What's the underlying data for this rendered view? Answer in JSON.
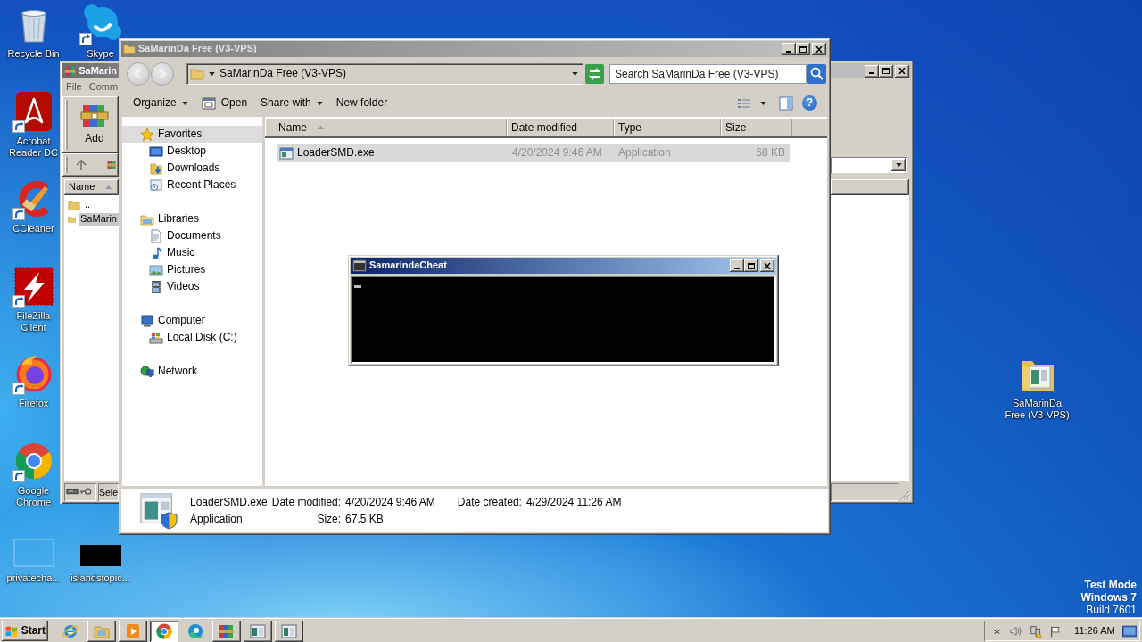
{
  "desktop_icons": [
    {
      "label": "Recycle Bin",
      "shortcut": false
    },
    {
      "label": "Skype",
      "shortcut": true
    },
    {
      "label": "Acrobat Reader DC",
      "shortcut": true
    },
    {
      "label": "CCleaner",
      "shortcut": true
    },
    {
      "label": "FileZilla Client",
      "shortcut": true
    },
    {
      "label": "Firefox",
      "shortcut": true
    },
    {
      "label": "Google Chrome",
      "shortcut": true
    },
    {
      "label": "privatecha...",
      "shortcut": false
    },
    {
      "label": "islandstopic...",
      "shortcut": false
    },
    {
      "label": "SaMarinDa Free (V3-VPS)",
      "shortcut": false
    }
  ],
  "archive_window": {
    "title": "SaMarin",
    "menu": [
      "File",
      "Comm"
    ],
    "toolbar": [
      "Add"
    ],
    "columns": [
      {
        "label": "Name",
        "sorted": true
      }
    ],
    "rows": [
      {
        "name": "..",
        "selected": false
      },
      {
        "name": "SaMarin",
        "selected": true
      }
    ],
    "status": "Sele"
  },
  "explorer": {
    "title": "SaMarinDa Free (V3-VPS)",
    "address": "SaMarinDa Free (V3-VPS)",
    "search": {
      "placeholder": "Search SaMarinDa Free (V3-VPS)"
    },
    "toolbar": [
      {
        "label": "Organize",
        "dropdown": true
      },
      {
        "label": "Open",
        "dropdown": false
      },
      {
        "label": "Share with",
        "dropdown": true
      },
      {
        "label": "New folder",
        "dropdown": false
      }
    ],
    "help": "?",
    "navigation": [
      {
        "label": "Favorites",
        "selected": true,
        "children": [
          {
            "label": "Desktop",
            "selected": false
          },
          {
            "label": "Downloads",
            "selected": false
          },
          {
            "label": "Recent Places",
            "selected": false
          }
        ]
      },
      {
        "label": "Libraries",
        "selected": false,
        "children": [
          {
            "label": "Documents",
            "selected": false
          },
          {
            "label": "Music",
            "selected": false
          },
          {
            "label": "Pictures",
            "selected": false
          },
          {
            "label": "Videos",
            "selected": false
          }
        ]
      },
      {
        "label": "Computer",
        "selected": false,
        "children": [
          {
            "label": "Local Disk (C:)",
            "selected": false
          }
        ]
      },
      {
        "label": "Network",
        "selected": false
      }
    ],
    "columns": [
      {
        "label": "Name",
        "sorted": true
      },
      {
        "label": "Date modified",
        "sorted": false
      },
      {
        "label": "Type",
        "sorted": false
      },
      {
        "label": "Size",
        "sorted": false
      }
    ],
    "files": [
      {
        "name": "LoaderSMD.exe",
        "date_modified": "4/20/2024 9:46 AM",
        "type": "Application",
        "size": "68 KB",
        "selected": true
      }
    ],
    "details": {
      "name": "LoaderSMD.exe",
      "type": "Application",
      "fields": [
        {
          "label": "Date modified:",
          "value": "4/20/2024 9:46 AM"
        },
        {
          "label": "Size:",
          "value": "67.5 KB"
        },
        {
          "label": "Date created:",
          "value": "4/29/2024 11:26 AM"
        }
      ]
    }
  },
  "console": {
    "title": "SamarindaCheat"
  },
  "desktop_notice": [
    "Test Mode",
    "Windows 7",
    "Build 7601"
  ],
  "taskbar": {
    "start": "Start",
    "buttons": [
      {
        "running": false,
        "selected": false
      },
      {
        "running": true,
        "selected": false
      },
      {
        "running": true,
        "selected": false
      },
      {
        "running": true,
        "selected": true
      },
      {
        "running": false,
        "selected": false
      },
      {
        "running": true,
        "selected": false
      },
      {
        "running": true,
        "selected": false
      },
      {
        "running": true,
        "selected": false
      }
    ],
    "time": "11:26 AM"
  }
}
